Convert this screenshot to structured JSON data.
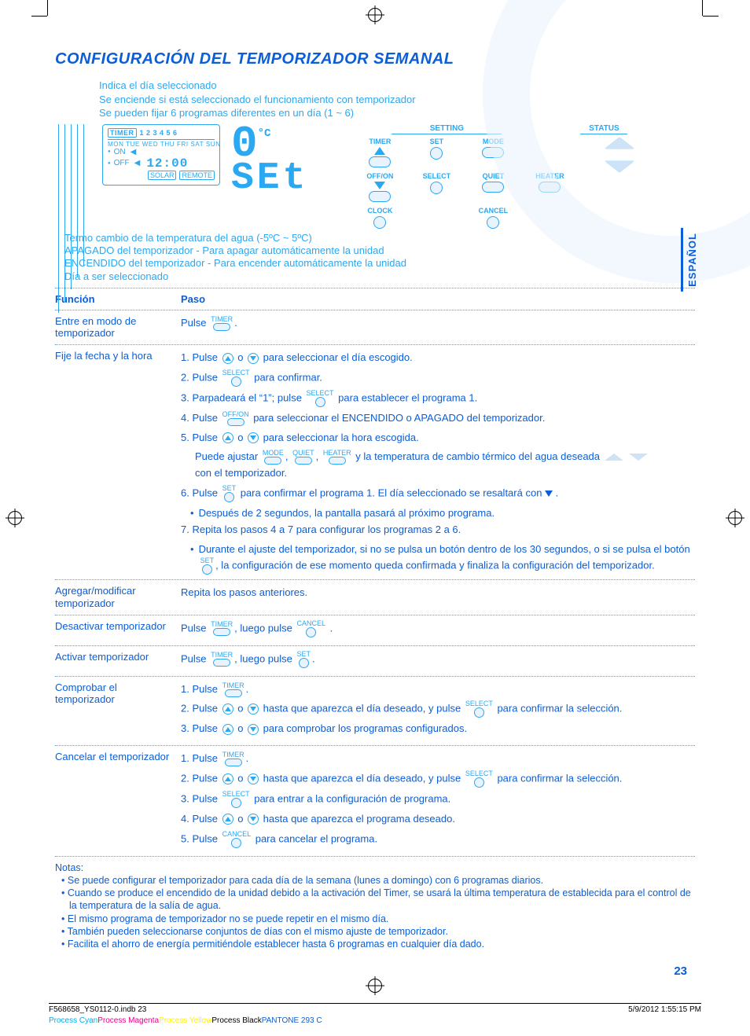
{
  "title": "CONFIGURACIÓN DEL TEMPORIZADOR SEMANAL",
  "lang_tab": "ESPAÑOL",
  "page_number": "23",
  "legend": {
    "l0": "Indica el día seleccionado",
    "l1": "Se enciende si está seleccionado el funcionamiento con temporizador",
    "l2": "Se pueden fijar 6 programas diferentes en un día (1 ~ 6)"
  },
  "lcd": {
    "timer": "TIMER",
    "nums": "1 2 3 4 5 6",
    "days": "MON TUE WED THU FRI SAT SUN",
    "on": "ON",
    "off": "OFF",
    "clock": "12:00",
    "solar": "SOLAR",
    "remote": "REMOTE",
    "big0": "0",
    "unitC": "°C",
    "set": "SEt"
  },
  "post_diag": {
    "p1": "Termo cambio de la temperatura del agua (-5ºC ~ 5ºC)",
    "p2": "APAGADO del temporizador - Para apagar automáticamente la unidad",
    "p3": "ENCENDIDO del temporizador - Para encender automáticamente la unidad",
    "p4": "Día a ser seleccionado"
  },
  "panel": {
    "setting": "SETTING",
    "status": "STATUS",
    "timer": "TIMER",
    "set": "SET",
    "mode": "MODE",
    "offon": "OFF/ON",
    "select": "SELECT",
    "quiet": "QUIET",
    "heater": "HEATER",
    "clock": "CLOCK",
    "cancel": "CANCEL"
  },
  "tab": {
    "funcion": "Función",
    "paso": "Paso"
  },
  "rows": {
    "r1_f": "Entre en modo de temporizador",
    "r1_p": "Pulse ",
    "r2_f": "Fije la fecha y la hora",
    "r2_1a": "1. Pulse ",
    "r2_1b": " o ",
    "r2_1c": " para seleccionar el día escogido.",
    "r2_2a": "2. Pulse ",
    "r2_2b": " para confirmar.",
    "r2_3a": "3. Parpadeará el “1”; pulse ",
    "r2_3b": " para establecer el programa 1.",
    "r2_4a": "4. Pulse ",
    "r2_4b": " para seleccionar el ENCENDIDO o APAGADO del temporizador.",
    "r2_5a": "5. Pulse ",
    "r2_5b": " o ",
    "r2_5c": " para seleccionar la hora escogida.",
    "r2_5d": "Puede ajustar ",
    "r2_5e": ", ",
    "r2_5f": ", ",
    "r2_5g": " y la temperatura de cambio térmico del agua deseada ",
    "r2_5h": " con el temporizador.",
    "r2_6a": "6. Pulse ",
    "r2_6b": " para confirmar el programa 1. El día seleccionado se resaltará con ",
    "r2_6c": " .",
    "r2_6d": "Después de 2 segundos, la pantalla pasará al próximo programa.",
    "r2_7": "7. Repita los pasos 4 a 7 para configurar los programas 2 a 6.",
    "r2_7b1": "Durante el ajuste del temporizador, si no se pulsa un botón dentro de los 30 segundos, o si se pulsa el botón ",
    "r2_7b2": ", la configuración de ese momento queda confirmada y finaliza la configuración del temporizador.",
    "r3_f": "Agregar/modificar temporizador",
    "r3_p": "Repita los pasos anteriores.",
    "r4_f": "Desactivar temporizador",
    "r4_pa": "Pulse ",
    "r4_pb": ", luego pulse ",
    "r4_pc": " .",
    "r5_f": "Activar temporizador",
    "r5_pa": "Pulse ",
    "r5_pb": ", luego pulse ",
    "r5_pc": ".",
    "r6_f": "Comprobar el temporizador",
    "r6_1a": "1. Pulse ",
    "r6_1b": ".",
    "r6_2a": "2. Pulse ",
    "r6_2b": " o ",
    "r6_2c": " hasta que aparezca el día deseado, y pulse ",
    "r6_2d": " para confirmar la selección.",
    "r6_3a": "3. Pulse ",
    "r6_3b": " o ",
    "r6_3c": " para comprobar los programas configurados.",
    "r7_f": "Cancelar el temporizador",
    "r7_1a": "1. Pulse ",
    "r7_1b": ".",
    "r7_2a": "2. Pulse ",
    "r7_2b": " o ",
    "r7_2c": " hasta que aparezca el día deseado, y pulse ",
    "r7_2d": " para confirmar la selección.",
    "r7_3a": "3. Pulse ",
    "r7_3b": " para entrar a la configuración de programa.",
    "r7_4a": "4. Pulse ",
    "r7_4b": " o ",
    "r7_4c": " hasta que aparezca el programa deseado.",
    "r7_5a": "5. Pulse ",
    "r7_5b": " para cancelar el programa."
  },
  "notes_title": "Notas:",
  "notes": [
    "Se puede configurar el temporizador para cada día de la semana (lunes a domingo) con 6 programas diarios.",
    "Cuando se produce el encendido de la unidad debido a la activación del Timer, se usará la última temperatura de establecida para el control de la temperatura de la salía de agua.",
    "El mismo programa de temporizador no se puede repetir en el mismo día.",
    "También pueden seleccionarse conjuntos de días con el mismo ajuste de temporizador.",
    "Facilita el ahorro de energía permitiéndole establecer hasta 6 programas en cualquier día dado."
  ],
  "footer": {
    "file": "F568658_YS0112-0.indb   23",
    "date": "5/9/2012   1:55:15 PM",
    "proc_cyan": "Process Cyan",
    "proc_mag": "Process Magenta",
    "proc_yel": "Process Yellow",
    "proc_blk": "Process Black",
    "pantone": "PANTONE 293 C"
  }
}
